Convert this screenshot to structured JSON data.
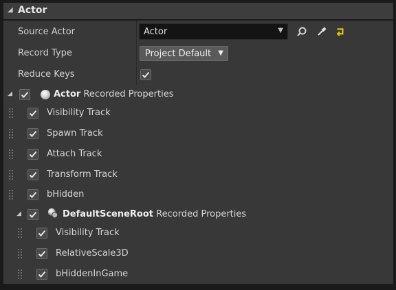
{
  "section": {
    "title": "Actor"
  },
  "properties": {
    "source_actor": {
      "label": "Source Actor",
      "value": "Actor"
    },
    "record_type": {
      "label": "Record Type",
      "value": "Project Default"
    },
    "reduce_keys": {
      "label": "Reduce Keys",
      "checked": true
    }
  },
  "actor_group": {
    "name": "Actor",
    "suffix": "Recorded Properties",
    "checked": true,
    "items": [
      {
        "label": "Visibility Track",
        "checked": true
      },
      {
        "label": "Spawn Track",
        "checked": true
      },
      {
        "label": "Attach Track",
        "checked": true
      },
      {
        "label": "Transform Track",
        "checked": true
      },
      {
        "label": "bHidden",
        "checked": true
      }
    ]
  },
  "component_group": {
    "name": "DefaultSceneRoot",
    "suffix": "Recorded Properties",
    "checked": true,
    "items": [
      {
        "label": "Visibility Track",
        "checked": true
      },
      {
        "label": "RelativeScale3D",
        "checked": true
      },
      {
        "label": "bHiddenInGame",
        "checked": true
      }
    ]
  },
  "icons": {
    "collapse": "triangle-down",
    "browse": "search-icon",
    "picker": "eyedropper-icon",
    "reset": "use-selected-icon",
    "check": "check-icon",
    "grip": "drag-handle-icon"
  },
  "colors": {
    "background": "#383838",
    "header": "#3d3d3d",
    "accent": "#e8d000"
  }
}
